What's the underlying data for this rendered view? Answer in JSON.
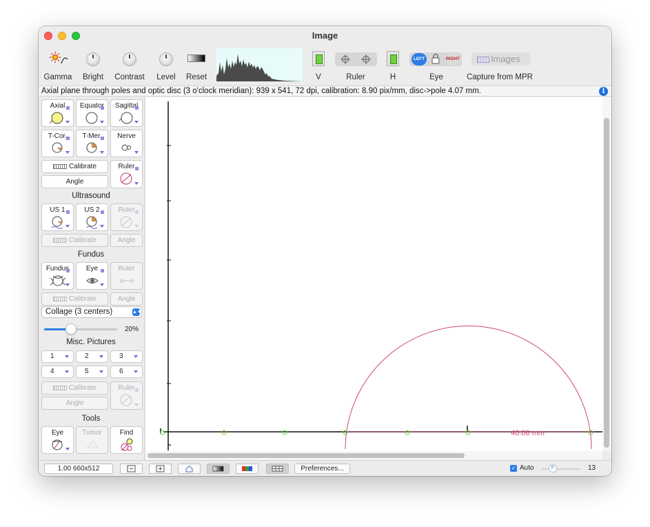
{
  "window": {
    "title": "Image"
  },
  "toolbar": {
    "gamma": "Gamma",
    "bright": "Bright",
    "contrast": "Contrast",
    "level": "Level",
    "reset": "Reset",
    "v": "V",
    "ruler": "Ruler",
    "h": "H",
    "eye": "Eye",
    "eye_left": "LEFT",
    "eye_right": "RIGHT",
    "images_btn": "Images",
    "capture": "Capture from MPR"
  },
  "info": {
    "text": "Axial plane through poles and optic disc (3 o'clock meridian): 939 x 541, 72 dpi, calibration: 8.90 pix/mm, disc->pole 4.07 mm."
  },
  "sidebar": {
    "planes": {
      "axial": "Axial",
      "equator": "Equator",
      "sagittal": "Sagittal",
      "tcor": "T-Cor.",
      "tmer": "T-Mer.",
      "nerve": "Nerve",
      "calibrate": "Calibrate",
      "angle": "Angle",
      "ruler": "Ruler"
    },
    "ultrasound": {
      "title": "Ultrasound",
      "us1": "US 1",
      "us2": "US 2",
      "ruler": "Ruler",
      "calibrate": "Calibrate",
      "angle": "Angle"
    },
    "fundus": {
      "title": "Fundus",
      "fundus": "Fundus",
      "eye": "Eye",
      "ruler": "Ruler",
      "calibrate": "Calibrate",
      "angle": "Angle"
    },
    "collage": {
      "value": "Collage (3 centers)",
      "slider_percent": "20%",
      "slider_fraction": 0.2
    },
    "misc": {
      "title": "Misc. Pictures",
      "items": [
        "1",
        "2",
        "3",
        "4",
        "5",
        "6"
      ],
      "calibrate": "Calibrate",
      "angle": "Angle",
      "ruler": "Ruler"
    },
    "tools": {
      "title": "Tools",
      "eye": "Eye",
      "tumor": "Tumor",
      "find": "Find"
    }
  },
  "canvas": {
    "measurement_label": "40.08 mm",
    "arc_color": "#d0467a"
  },
  "statusbar": {
    "zoom": "1.00 660x512",
    "preferences": "Preferences...",
    "auto_label": "Auto",
    "auto_checked": true,
    "slider_letter": "F",
    "slider_value": "13"
  },
  "colors": {
    "accent": "#2c7de6",
    "green": "#6fd13f"
  }
}
